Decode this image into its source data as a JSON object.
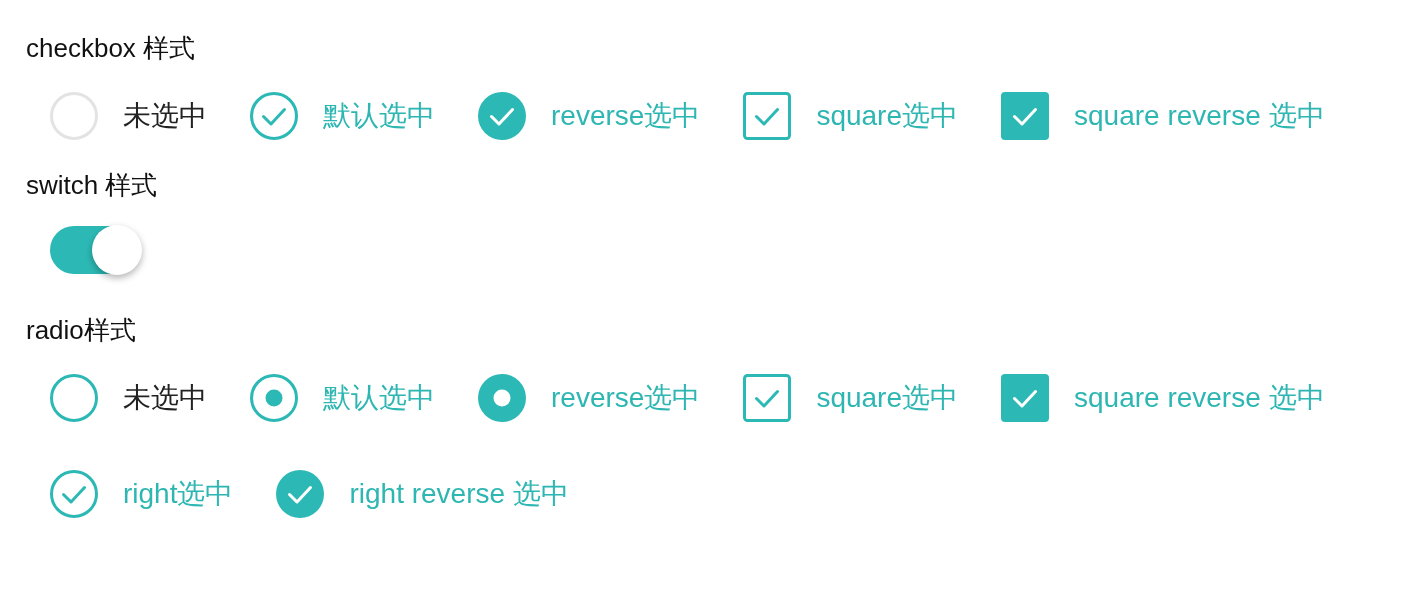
{
  "sections": [
    {
      "title": "checkbox 样式",
      "kind": "checkbox",
      "rows": [
        [
          {
            "label": "未选中",
            "kind": "tick-circle",
            "checked": false
          },
          {
            "label": "默认选中",
            "kind": "tick-circle",
            "reverse": false,
            "checked": true
          },
          {
            "label": "reverse选中",
            "kind": "tick-circle",
            "reverse": true,
            "checked": true
          },
          {
            "label": "square选中",
            "kind": "tick-square",
            "reverse": false,
            "checked": true
          },
          {
            "label": "square reverse 选中",
            "kind": "tick-square",
            "reverse": true,
            "checked": true
          }
        ]
      ]
    },
    {
      "title": "switch 样式",
      "kind": "switch",
      "on": true
    },
    {
      "title": "radio样式",
      "kind": "radio",
      "rows": [
        [
          {
            "label": "未选中",
            "kind": "dot-circle",
            "selected": false
          },
          {
            "label": "默认选中",
            "kind": "dot-circle",
            "reverse": false,
            "selected": true
          },
          {
            "label": "reverse选中",
            "kind": "dot-circle",
            "reverse": true,
            "selected": true
          },
          {
            "label": "square选中",
            "kind": "tick-square",
            "reverse": false,
            "selected": true
          },
          {
            "label": "square reverse 选中",
            "kind": "tick-square",
            "reverse": true,
            "selected": true
          }
        ],
        [
          {
            "label": "right选中",
            "kind": "tick-circle",
            "reverse": false,
            "selected": true
          },
          {
            "label": "right reverse 选中",
            "kind": "tick-circle",
            "reverse": true,
            "selected": true
          }
        ]
      ]
    }
  ]
}
